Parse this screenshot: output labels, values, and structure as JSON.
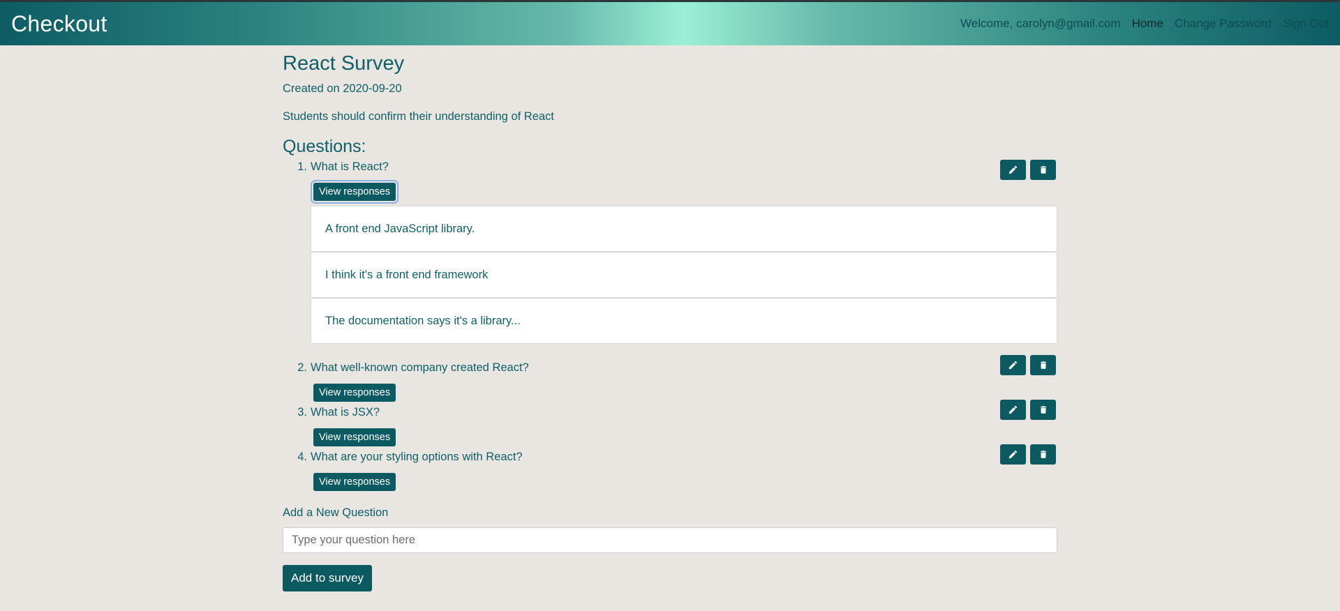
{
  "nav": {
    "brand": "Checkout",
    "welcome": "Welcome, carolyn@gmail.com",
    "links": [
      "Home",
      "Change Password",
      "Sign Out"
    ]
  },
  "survey": {
    "title": "React Survey",
    "created": "Created on 2020-09-20",
    "description": "Students should confirm their understanding of React",
    "questions_heading": "Questions:",
    "view_label": "View responses",
    "questions": [
      {
        "num": "1.",
        "text": "What is React?"
      },
      {
        "num": "2.",
        "text": "What well-known company created React?"
      },
      {
        "num": "3.",
        "text": "What is JSX?"
      },
      {
        "num": "4.",
        "text": "What are your styling options with React?"
      }
    ],
    "responses": [
      "A front end JavaScript library.",
      "I think it's a front end framework",
      "The documentation says it's a library..."
    ]
  },
  "add": {
    "label": "Add a New Question",
    "placeholder": "Type your question here",
    "button": "Add to survey"
  },
  "icons": {
    "edit": "pencil-icon",
    "delete": "trash-icon"
  },
  "colors": {
    "primary": "#0b5a62",
    "background": "#e9e6e2",
    "text": "#0e5f66"
  }
}
